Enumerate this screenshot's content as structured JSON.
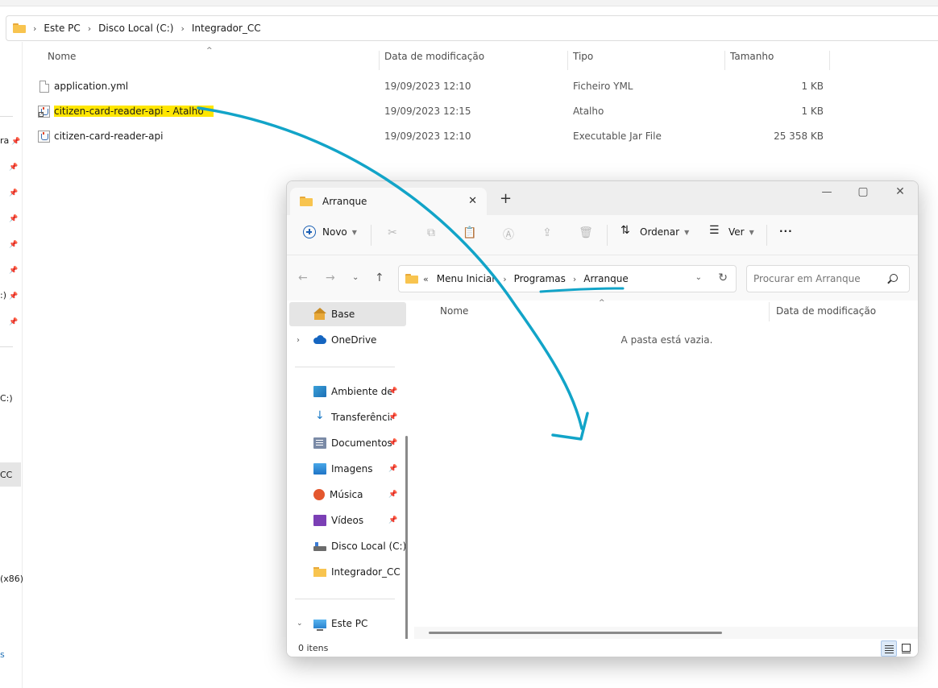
{
  "background_window": {
    "breadcrumb": [
      "Este PC",
      "Disco Local (C:)",
      "Integrador_CC"
    ],
    "columns": {
      "name": "Nome",
      "date": "Data de modificação",
      "type": "Tipo",
      "size": "Tamanho"
    },
    "files": [
      {
        "name": "application.yml",
        "date": "19/09/2023 12:10",
        "type": "Ficheiro YML",
        "size": "1 KB",
        "icon": "file-icon"
      },
      {
        "name": "citizen-card-reader-api - Atalho",
        "date": "19/09/2023 12:15",
        "type": "Atalho",
        "size": "1 KB",
        "icon": "shortcut-icon"
      },
      {
        "name": "citizen-card-reader-api",
        "date": "19/09/2023 12:10",
        "type": "Executable Jar File",
        "size": "25 358 KB",
        "icon": "jar-icon"
      }
    ],
    "left_pane_fragments": [
      "ra",
      ":)",
      "C:)",
      "CC",
      "(x86)",
      "s"
    ]
  },
  "window": {
    "tab_title": "Arranque",
    "toolbar": {
      "new_label": "Novo",
      "sort_label": "Ordenar",
      "view_label": "Ver",
      "more_label": "···"
    },
    "address": {
      "overflow": "«",
      "path": [
        "Menu Iniciar",
        "Programas",
        "Arranque"
      ]
    },
    "search_placeholder": "Procurar em Arranque",
    "nav": {
      "home": "Base",
      "onedrive": "OneDrive",
      "quick_access": [
        {
          "label": "Ambiente de trabalho",
          "icon": "desktop-icon"
        },
        {
          "label": "Transferências",
          "icon": "download-icon"
        },
        {
          "label": "Documentos",
          "icon": "documents-icon"
        },
        {
          "label": "Imagens",
          "icon": "pictures-icon"
        },
        {
          "label": "Música",
          "icon": "music-icon"
        },
        {
          "label": "Vídeos",
          "icon": "videos-icon"
        },
        {
          "label": "Disco Local (C:)",
          "icon": "drive-icon"
        },
        {
          "label": "Integrador_CC",
          "icon": "folder-icon"
        }
      ],
      "this_pc": "Este PC"
    },
    "columns": {
      "name": "Nome",
      "date": "Data de modificação"
    },
    "empty_message": "A pasta está vazia.",
    "status": "0 itens"
  },
  "colors": {
    "annotation": "#12a4c8",
    "highlight": "#ffe600",
    "selection": "#e5e5e5"
  }
}
